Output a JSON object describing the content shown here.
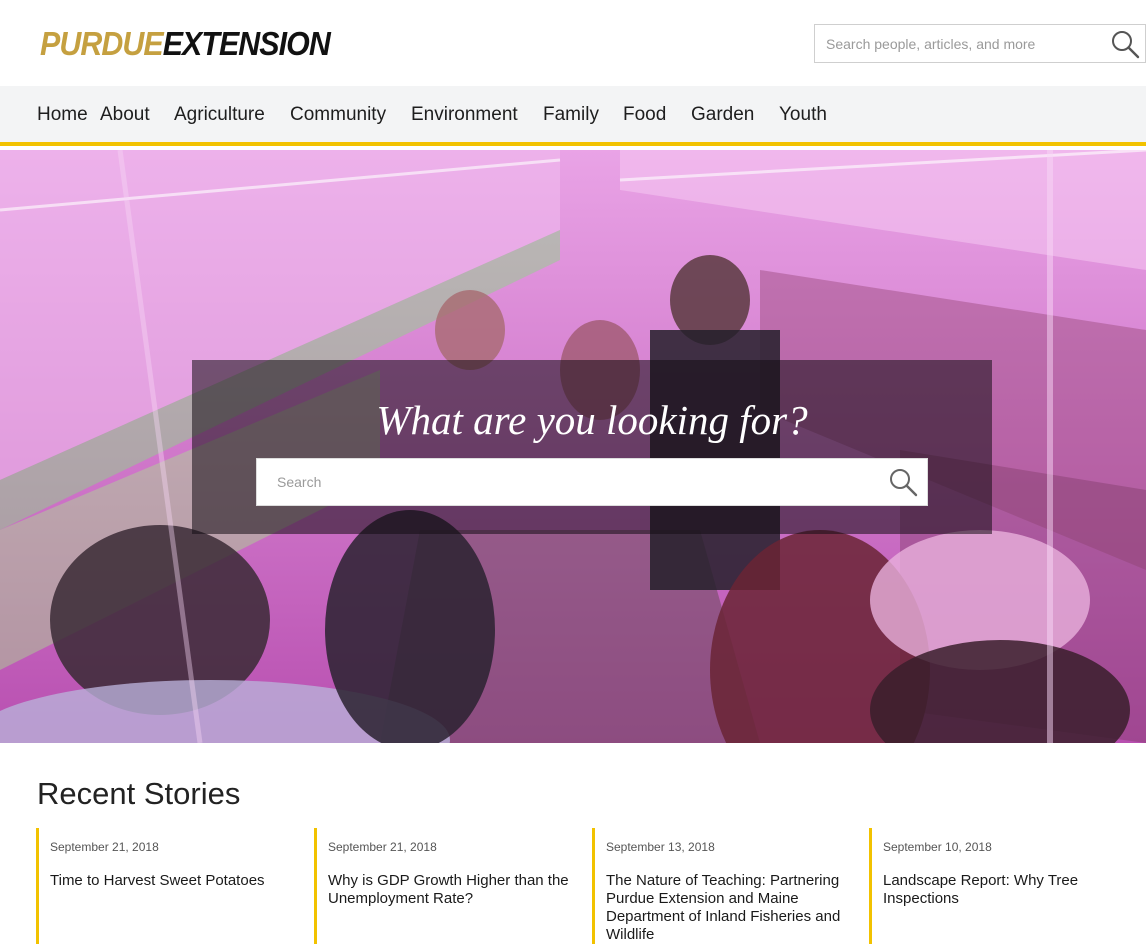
{
  "header": {
    "logo": {
      "word1": "PURDUE",
      "word2": "EXTENSION"
    },
    "search_placeholder": "Search people, articles, and more",
    "search_icon": "search-icon"
  },
  "nav": {
    "items": [
      "Home",
      "About",
      "Agriculture",
      "Community",
      "Environment",
      "Family",
      "Food",
      "Garden",
      "Youth"
    ]
  },
  "hero": {
    "title": "What are you looking for?",
    "search_placeholder": "Search",
    "search_icon": "search-icon"
  },
  "stories": {
    "section_title": "Recent Stories",
    "items": [
      {
        "date": "September 21, 2018",
        "title": "Time to Harvest Sweet Potatoes"
      },
      {
        "date": "September 21, 2018",
        "title": "Why is GDP Growth Higher than the Unemployment Rate?"
      },
      {
        "date": "September 13, 2018",
        "title": "The Nature of Teaching: Partnering Purdue Extension and Maine Department of Inland Fisheries and Wildlife"
      },
      {
        "date": "September 10, 2018",
        "title": "Landscape Report: Why Tree Inspections"
      }
    ]
  },
  "colors": {
    "accent_gold": "#f2c200",
    "logo_gold": "#c5a040",
    "nav_bg": "#f3f4f5"
  }
}
